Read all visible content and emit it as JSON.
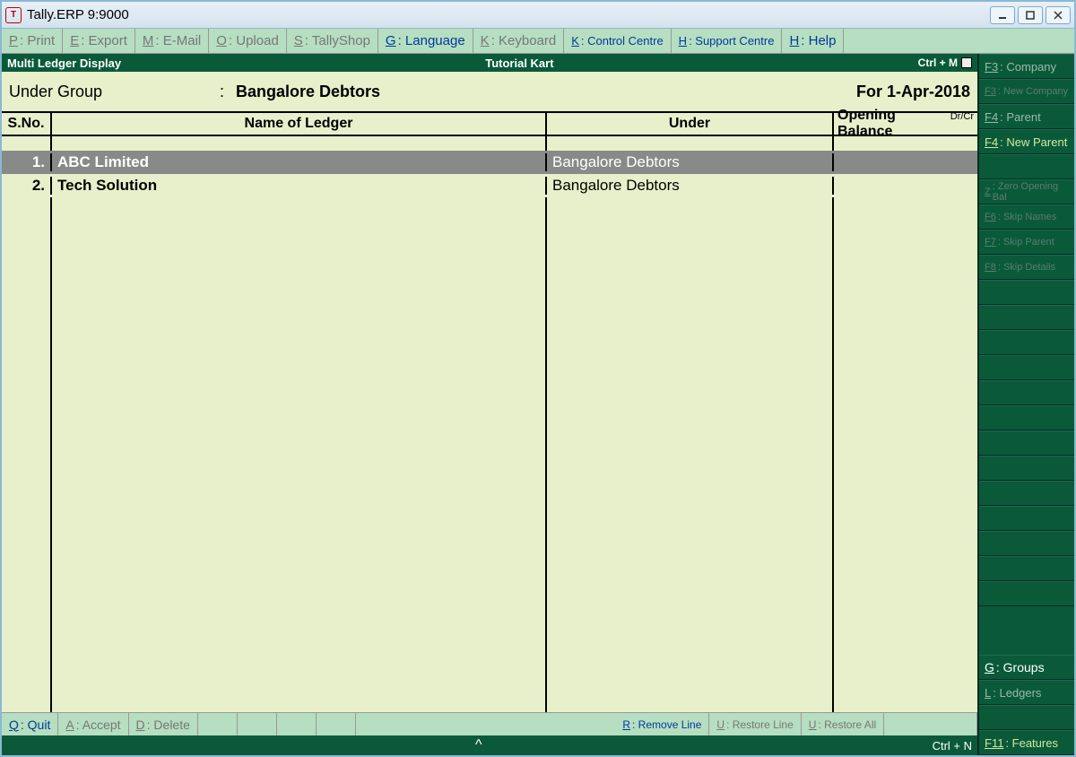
{
  "titlebar": {
    "text": "Tally.ERP 9:9000",
    "icon": "T"
  },
  "topmenu": [
    {
      "key": "P",
      "label": "Print",
      "cls": ""
    },
    {
      "key": "E",
      "label": "Export",
      "cls": ""
    },
    {
      "key": "M",
      "label": "E-Mail",
      "cls": ""
    },
    {
      "key": "O",
      "label": "Upload",
      "cls": ""
    },
    {
      "key": "S",
      "label": "TallyShop",
      "cls": ""
    },
    {
      "key": "G",
      "label": "Language",
      "cls": "active"
    },
    {
      "key": "K",
      "label": "Keyboard",
      "cls": ""
    },
    {
      "key": "K",
      "label": "Control Centre",
      "cls": "active small"
    },
    {
      "key": "H",
      "label": "Support Centre",
      "cls": "active small"
    },
    {
      "key": "H",
      "label": "Help",
      "cls": "active"
    }
  ],
  "header": {
    "left": "Multi Ledger  Display",
    "center": "Tutorial Kart",
    "right": "Ctrl + M"
  },
  "group": {
    "label": "Under Group",
    "value": "Bangalore Debtors",
    "date": "For 1-Apr-2018"
  },
  "table": {
    "headers": {
      "sno": "S.No.",
      "name": "Name of Ledger",
      "under": "Under",
      "balance": "Opening Balance",
      "drcr": "Dr/Cr"
    },
    "rows": [
      {
        "sno": "1.",
        "name": "ABC Limited",
        "under": "Bangalore Debtors",
        "selected": true
      },
      {
        "sno": "2.",
        "name": "Tech Solution",
        "under": "Bangalore Debtors",
        "selected": false
      }
    ]
  },
  "bottommenu": {
    "left": [
      {
        "key": "Q",
        "label": "Quit",
        "cls": "active"
      },
      {
        "key": "A",
        "label": "Accept",
        "cls": ""
      },
      {
        "key": "D",
        "label": "Delete",
        "cls": ""
      }
    ],
    "right": [
      {
        "key": "R",
        "label": "Remove Line",
        "cls": "active small"
      },
      {
        "key": "U",
        "label": "Restore Line",
        "cls": "small"
      },
      {
        "key": "U",
        "label": "Restore All",
        "cls": "small"
      }
    ]
  },
  "footer": {
    "center": "^",
    "right": "Ctrl + N"
  },
  "side": [
    {
      "key": "F3",
      "label": "Company",
      "cls": ""
    },
    {
      "key": "F3",
      "label": "New Company",
      "cls": "disabled"
    },
    {
      "key": "F4",
      "label": "Parent",
      "cls": ""
    },
    {
      "key": "F4",
      "label": "New Parent",
      "cls": "active"
    },
    {
      "key": "",
      "label": "",
      "cls": "empty"
    },
    {
      "key": "Z",
      "label": "Zero Opening Bal",
      "cls": "disabled"
    },
    {
      "key": "F6",
      "label": "Skip Names",
      "cls": "disabled"
    },
    {
      "key": "F7",
      "label": "Skip Parent",
      "cls": "disabled"
    },
    {
      "key": "F8",
      "label": "Skip Details",
      "cls": "disabled"
    }
  ],
  "side_bottom": [
    {
      "key": "G",
      "label": "Groups",
      "cls": "bright"
    },
    {
      "key": "L",
      "label": "Ledgers",
      "cls": ""
    },
    {
      "key": "",
      "label": "",
      "cls": "empty"
    },
    {
      "key": "F11",
      "label": "Features",
      "cls": "active"
    }
  ]
}
